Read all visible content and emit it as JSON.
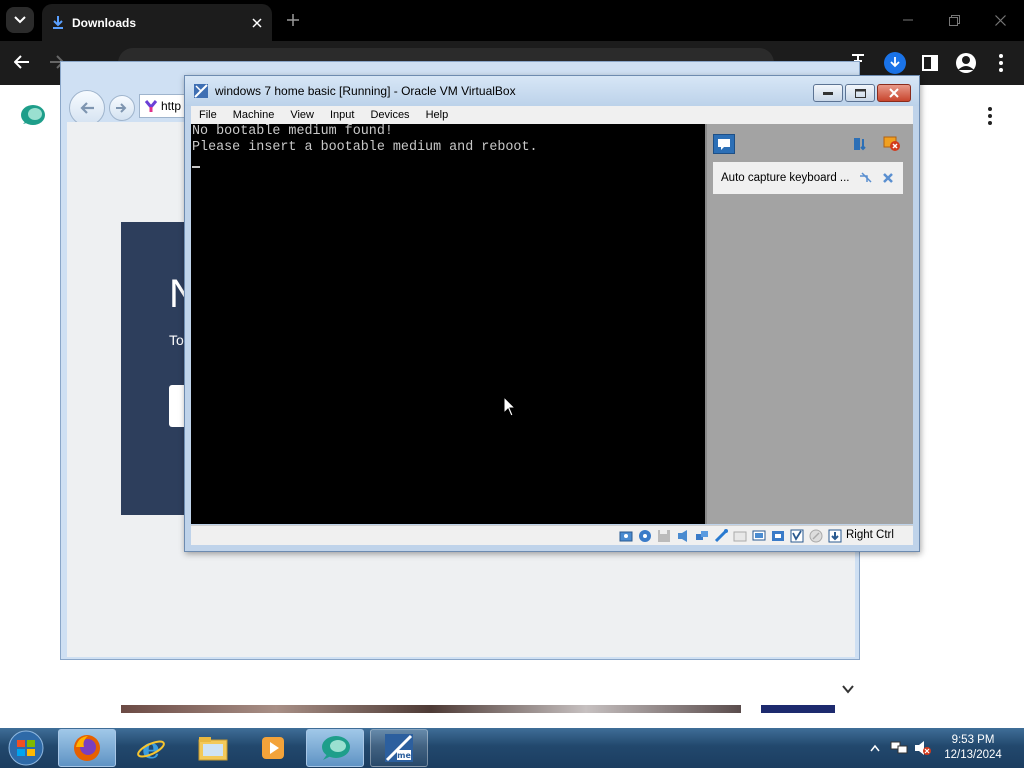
{
  "browser": {
    "active_tab": {
      "title": "Downloads",
      "icon": "download-icon"
    },
    "new_tab_icon": "plus-icon",
    "window_controls": [
      "minimize-icon",
      "restore-icon",
      "close-icon"
    ],
    "toolbar_icons": [
      "back-icon",
      "forward-icon",
      "extensions-icon",
      "brush-icon",
      "download-icon",
      "sidepanel-icon",
      "profile-icon",
      "kebab-menu-icon"
    ]
  },
  "ie_window": {
    "address_text": "http",
    "hero_big": "N",
    "hero_sub": "To"
  },
  "virtualbox": {
    "title": "windows 7 home basic [Running] - Oracle VM VirtualBox",
    "menu": [
      "File",
      "Machine",
      "View",
      "Input",
      "Devices",
      "Help"
    ],
    "console_lines": "No bootable medium found!\nPlease insert a bootable medium and reboot.",
    "notification": {
      "text": "Auto capture keyboard ..."
    },
    "host_key": "Right Ctrl"
  },
  "taskbar": {
    "items": [
      {
        "name": "firefox",
        "icon": "firefox-icon",
        "state": "active"
      },
      {
        "name": "internet-explorer",
        "icon": "ie-icon",
        "state": "none"
      },
      {
        "name": "explorer",
        "icon": "folder-icon",
        "state": "none"
      },
      {
        "name": "media-player",
        "icon": "media-player-icon",
        "state": "none"
      },
      {
        "name": "chat-app",
        "icon": "chat-app-icon",
        "state": "active"
      },
      {
        "name": "virtualbox",
        "icon": "virtualbox-icon",
        "state": "running"
      }
    ],
    "clock": {
      "time": "9:53 PM",
      "date": "12/13/2024"
    }
  },
  "colors": {
    "chrome_dark": "#1c1c1c",
    "vbox_frame": "#bfd3ea",
    "taskbar": "#22486d",
    "hero": "#2d3e5c"
  }
}
